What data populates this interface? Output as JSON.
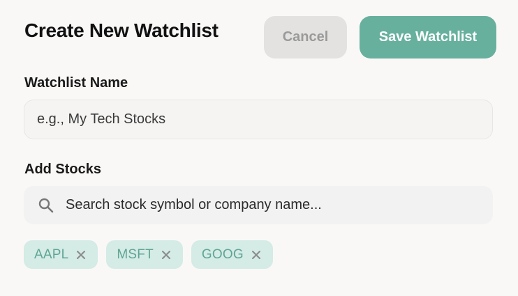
{
  "header": {
    "title": "Create New Watchlist",
    "cancel_label": "Cancel",
    "save_label": "Save Watchlist"
  },
  "form": {
    "name_label": "Watchlist Name",
    "name_placeholder": "e.g., My Tech Stocks",
    "name_value": "",
    "stocks_label": "Add Stocks",
    "search_placeholder": "Search stock symbol or company name...",
    "search_value": ""
  },
  "chips": [
    {
      "symbol": "AAPL"
    },
    {
      "symbol": "MSFT"
    },
    {
      "symbol": "GOOG"
    }
  ],
  "colors": {
    "accent": "#67b09e",
    "chip_bg": "#d4ebe6",
    "chip_text": "#5fa593",
    "cancel_bg": "#e3e2e1",
    "cancel_text": "#9a9a9a",
    "page_bg": "#faf8f6"
  },
  "icons": {
    "search": "search-icon",
    "remove": "close-icon"
  }
}
